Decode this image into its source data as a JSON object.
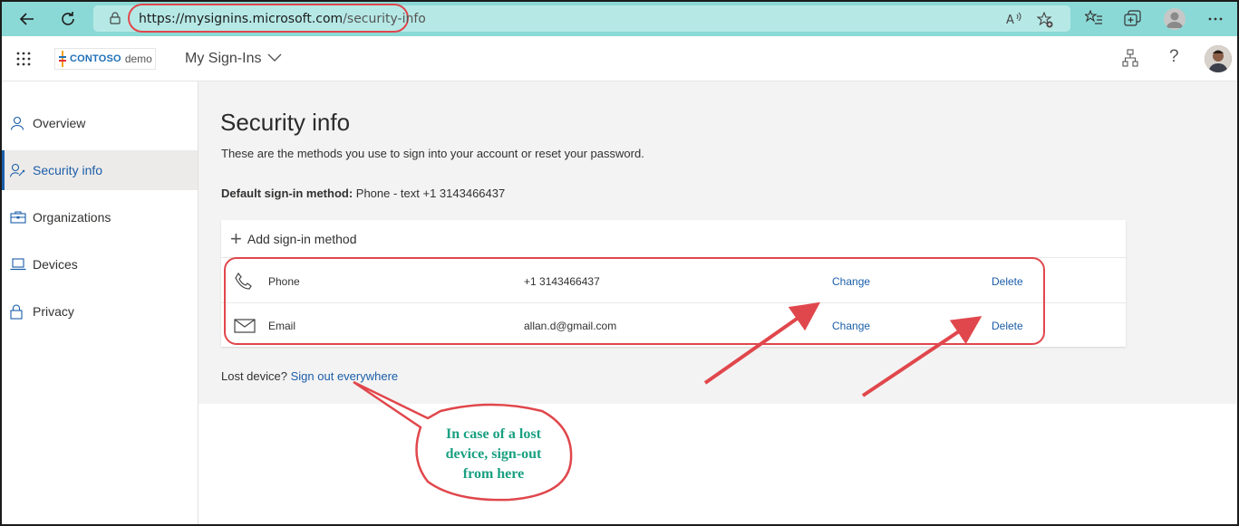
{
  "browser": {
    "url_domain": "https://mysignins.microsoft.com",
    "url_path": "/security-info"
  },
  "app": {
    "logo_brand": "CONTOSO",
    "logo_suffix": "demo",
    "title": "My Sign-Ins"
  },
  "sidebar": {
    "items": [
      {
        "label": "Overview",
        "icon": "person-icon"
      },
      {
        "label": "Security info",
        "icon": "person-key-icon",
        "active": true
      },
      {
        "label": "Organizations",
        "icon": "briefcase-icon"
      },
      {
        "label": "Devices",
        "icon": "laptop-icon"
      },
      {
        "label": "Privacy",
        "icon": "lock-icon"
      }
    ]
  },
  "main": {
    "title": "Security info",
    "description": "These are the methods you use to sign into your account or reset your password.",
    "default_method_label": "Default sign-in method:",
    "default_method_value": " Phone - text +1 3143466437",
    "add_method": "Add sign-in method",
    "methods": [
      {
        "type": "Phone",
        "value": "+1 3143466437",
        "change": "Change",
        "delete": "Delete",
        "icon": "phone-icon"
      },
      {
        "type": "Email",
        "value": "allan.d@gmail.com",
        "change": "Change",
        "delete": "Delete",
        "icon": "mail-icon"
      }
    ],
    "lost_device_label": "Lost device?",
    "lost_device_link": "Sign out everywhere"
  },
  "annotation": {
    "callout_line1": "In case of a lost",
    "callout_line2": "device, sign-out",
    "callout_line3": "from here",
    "accent_color": "#e0474c",
    "callout_text_color": "#1aa082"
  }
}
